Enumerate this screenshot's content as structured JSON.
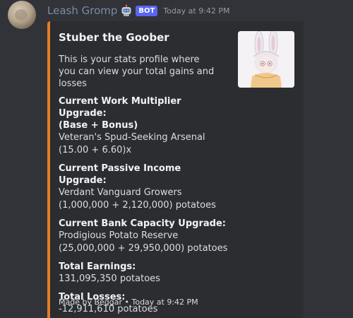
{
  "message": {
    "author": "Leash Gromp",
    "bot_badge": "BOT",
    "timestamp": "Today at 9:42 PM",
    "avatar_icon": "avatar-image",
    "robot_icon": "robot-icon"
  },
  "embed": {
    "accent_color": "#e67e22",
    "title": "Stuber the Goober",
    "description_line1": "This is your stats profile where",
    "description_line2": "you can view your total gains and losses",
    "fields": [
      {
        "name_line1": "Current Work Multiplier Upgrade:",
        "name_line2": "(Base + Bonus)",
        "value_line1": "Veteran's Spud-Seeking Arsenal",
        "value_line2": "(15.00 + 6.60)x"
      },
      {
        "name_line1": "Current Passive Income Upgrade:",
        "value_line1": "Verdant Vanguard Growers",
        "value_line2": "(1,000,000 + 2,120,000) potatoes"
      },
      {
        "name_line1": "Current Bank Capacity Upgrade:",
        "value_line1": "Prodigious Potato Reserve",
        "value_line2": "(25,000,000 + 29,950,000) potatoes"
      },
      {
        "name_line1": "Total Earnings:",
        "value_line1": "131,095,350 potatoes"
      },
      {
        "name_line1": "Total Losses:",
        "value_line1": "-12,911,610 potatoes"
      }
    ],
    "footer": "Made by Beggar • Today at 9:42 PM",
    "thumbnail_icon": "bunny-girl-thumbnail"
  }
}
